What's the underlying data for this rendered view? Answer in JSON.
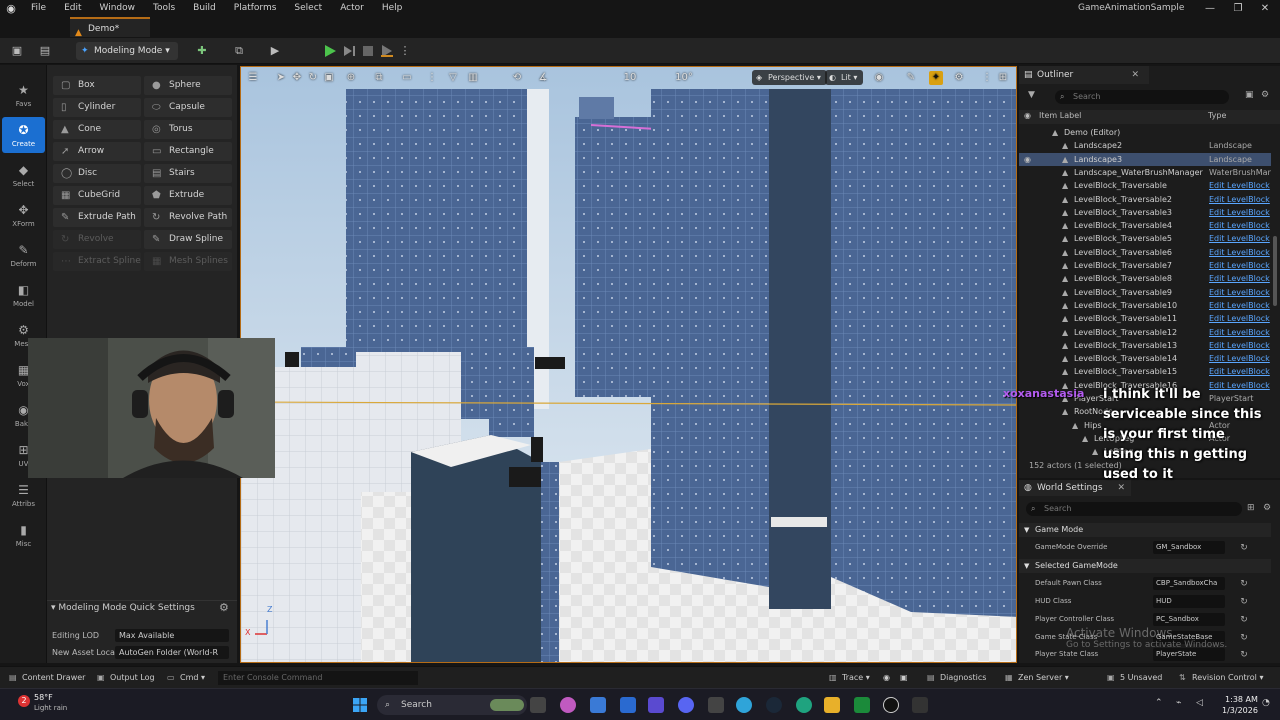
{
  "menu": {
    "items": [
      "File",
      "Edit",
      "Window",
      "Tools",
      "Build",
      "Platforms",
      "Select",
      "Actor",
      "Help"
    ],
    "app_title": "GameAnimationSample"
  },
  "doc_tab": {
    "label": "Demo*"
  },
  "toolbar": {
    "mode_label": "Modeling Mode"
  },
  "mode_strip": [
    {
      "label": "Favs",
      "icon": "star-icon"
    },
    {
      "label": "Create",
      "icon": "create-icon",
      "active": true
    },
    {
      "label": "Select",
      "icon": "select-icon"
    },
    {
      "label": "XForm",
      "icon": "xform-icon"
    },
    {
      "label": "Deform",
      "icon": "deform-icon"
    },
    {
      "label": "Model",
      "icon": "model-icon"
    },
    {
      "label": "Mesh",
      "icon": "mesh-icon"
    },
    {
      "label": "Vox",
      "icon": "vox-icon"
    },
    {
      "label": "Bake",
      "icon": "bake-icon"
    },
    {
      "label": "UV",
      "icon": "uv-icon"
    },
    {
      "label": "Attribs",
      "icon": "attribs-icon"
    },
    {
      "label": "Misc",
      "icon": "misc-icon"
    }
  ],
  "tools": [
    {
      "label": "Box",
      "glyph": "▢",
      "enabled": true
    },
    {
      "label": "Sphere",
      "glyph": "●",
      "enabled": true
    },
    {
      "label": "Cylinder",
      "glyph": "▯",
      "enabled": true
    },
    {
      "label": "Capsule",
      "glyph": "⬭",
      "enabled": true
    },
    {
      "label": "Cone",
      "glyph": "▲",
      "enabled": true
    },
    {
      "label": "Torus",
      "glyph": "◎",
      "enabled": true
    },
    {
      "label": "Arrow",
      "glyph": "➚",
      "enabled": true
    },
    {
      "label": "Rectangle",
      "glyph": "▭",
      "enabled": true
    },
    {
      "label": "Disc",
      "glyph": "◯",
      "enabled": true
    },
    {
      "label": "Stairs",
      "glyph": "▤",
      "enabled": true
    },
    {
      "label": "CubeGrid",
      "glyph": "▦",
      "enabled": true
    },
    {
      "label": "Extrude Polygon",
      "glyph": "⬟",
      "enabled": true
    },
    {
      "label": "Extrude Path",
      "glyph": "✎",
      "enabled": true
    },
    {
      "label": "Revolve Path",
      "glyph": "↻",
      "enabled": true
    },
    {
      "label": "Revolve Spline",
      "glyph": "↻",
      "enabled": false
    },
    {
      "label": "Draw Spline",
      "glyph": "✎",
      "enabled": true
    },
    {
      "label": "Extract Spline",
      "glyph": "⋯",
      "enabled": false
    },
    {
      "label": "Mesh Splines",
      "glyph": "▦",
      "enabled": false
    }
  ],
  "quick_settings": {
    "title": "Modeling Mode Quick Settings",
    "rows": [
      {
        "label": "Editing LOD",
        "value": "Max Available"
      },
      {
        "label": "New Asset Loca",
        "value": "AutoGen Folder (World-R"
      }
    ]
  },
  "viewport": {
    "perspective_label": "Perspective",
    "lit_label": "Lit",
    "grid_snap": "10",
    "rot_snap": "10°",
    "axis_z": "Z",
    "axis_x": "X"
  },
  "outliner": {
    "title": "Outliner",
    "search_placeholder": "Search",
    "col_label": "Item Label",
    "col_type": "Type",
    "rows": [
      {
        "label": "Demo (Editor)",
        "type": "",
        "depth": 0,
        "link": false
      },
      {
        "label": "Landscape2",
        "type": "Landscape",
        "depth": 1,
        "link": false
      },
      {
        "label": "Landscape3",
        "type": "Landscape",
        "depth": 1,
        "link": false,
        "selected": true
      },
      {
        "label": "Landscape_WaterBrushManager",
        "type": "WaterBrushMan",
        "depth": 1,
        "link": false
      },
      {
        "label": "LevelBlock_Traversable",
        "type": "Edit LevelBlock",
        "depth": 1,
        "link": true
      },
      {
        "label": "LevelBlock_Traversable2",
        "type": "Edit LevelBlock",
        "depth": 1,
        "link": true
      },
      {
        "label": "LevelBlock_Traversable3",
        "type": "Edit LevelBlock",
        "depth": 1,
        "link": true
      },
      {
        "label": "LevelBlock_Traversable4",
        "type": "Edit LevelBlock",
        "depth": 1,
        "link": true
      },
      {
        "label": "LevelBlock_Traversable5",
        "type": "Edit LevelBlock",
        "depth": 1,
        "link": true
      },
      {
        "label": "LevelBlock_Traversable6",
        "type": "Edit LevelBlock",
        "depth": 1,
        "link": true
      },
      {
        "label": "LevelBlock_Traversable7",
        "type": "Edit LevelBlock",
        "depth": 1,
        "link": true
      },
      {
        "label": "LevelBlock_Traversable8",
        "type": "Edit LevelBlock",
        "depth": 1,
        "link": true
      },
      {
        "label": "LevelBlock_Traversable9",
        "type": "Edit LevelBlock",
        "depth": 1,
        "link": true
      },
      {
        "label": "LevelBlock_Traversable10",
        "type": "Edit LevelBlock",
        "depth": 1,
        "link": true
      },
      {
        "label": "LevelBlock_Traversable11",
        "type": "Edit LevelBlock",
        "depth": 1,
        "link": true
      },
      {
        "label": "LevelBlock_Traversable12",
        "type": "Edit LevelBlock",
        "depth": 1,
        "link": true
      },
      {
        "label": "LevelBlock_Traversable13",
        "type": "Edit LevelBlock",
        "depth": 1,
        "link": true
      },
      {
        "label": "LevelBlock_Traversable14",
        "type": "Edit LevelBlock",
        "depth": 1,
        "link": true
      },
      {
        "label": "LevelBlock_Traversable15",
        "type": "Edit LevelBlock",
        "depth": 1,
        "link": true
      },
      {
        "label": "LevelBlock_Traversable16",
        "type": "Edit LevelBlock",
        "depth": 1,
        "link": true
      },
      {
        "label": "PlayerStart",
        "type": "PlayerStart",
        "depth": 1,
        "link": false
      },
      {
        "label": "RootNode",
        "type": "",
        "depth": 1,
        "link": false
      },
      {
        "label": "Hips",
        "type": "Actor",
        "depth": 2,
        "link": false
      },
      {
        "label": "LeftUpLeg",
        "type": "Actor",
        "depth": 3,
        "link": false
      },
      {
        "label": "LeftLeg",
        "type": "",
        "depth": 4,
        "link": false
      }
    ],
    "footer": "152 actors (1 selected)"
  },
  "world_settings": {
    "title": "World Settings",
    "search_placeholder": "Search",
    "sections": [
      {
        "title": "Game Mode",
        "rows": [
          {
            "label": "GameMode Override",
            "value": "GM_Sandbox"
          }
        ]
      },
      {
        "title": "Selected GameMode",
        "rows": [
          {
            "label": "Default Pawn Class",
            "value": "CBP_SandboxCha"
          },
          {
            "label": "HUD Class",
            "value": "HUD"
          },
          {
            "label": "Player Controller Class",
            "value": "PC_Sandbox"
          },
          {
            "label": "Game State Class",
            "value": "GameStateBase"
          },
          {
            "label": "Player State Class",
            "value": "PlayerState"
          }
        ]
      }
    ]
  },
  "chat": {
    "username": "xoxanastasia",
    "message": "i think it'll be serviceable since this is your first time using this n getting used to it"
  },
  "watermark": {
    "title": "Activate Windows",
    "subtitle": "Go to Settings to activate Windows."
  },
  "statusbar": {
    "content_drawer": "Content Drawer",
    "output_log": "Output Log",
    "cmd": "Cmd",
    "console_placeholder": "Enter Console Command",
    "trace": "Trace",
    "diagnostics": "Diagnostics",
    "zen_server": "Zen Server",
    "unsaved": "5 Unsaved",
    "revision_control": "Revision Control"
  },
  "taskbar": {
    "temp": "58°F",
    "condition": "Light rain",
    "notification_count": "2",
    "search_label": "Search",
    "time": "1:38 AM",
    "date": "1/3/2026"
  },
  "colors": {
    "accent": "#1b6fd1",
    "viewport_border": "#b56c16",
    "chat_user": "#b45cf0",
    "link": "#5aa6ff"
  }
}
